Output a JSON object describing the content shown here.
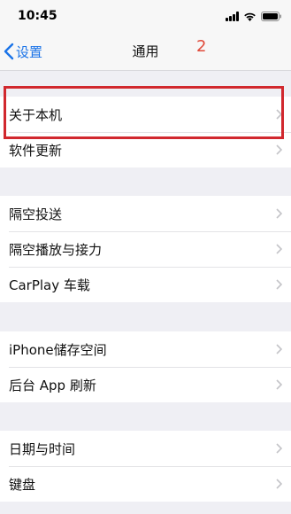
{
  "status_bar": {
    "time": "10:45"
  },
  "nav": {
    "back_label": "设置",
    "title": "通用"
  },
  "annotation": {
    "number": "2"
  },
  "groups": [
    {
      "items": [
        {
          "label": "关于本机"
        },
        {
          "label": "软件更新"
        }
      ]
    },
    {
      "items": [
        {
          "label": "隔空投送"
        },
        {
          "label": "隔空播放与接力"
        },
        {
          "label": "CarPlay 车载"
        }
      ]
    },
    {
      "items": [
        {
          "label": "iPhone储存空间"
        },
        {
          "label": "后台 App 刷新"
        }
      ]
    },
    {
      "items": [
        {
          "label": "日期与时间"
        },
        {
          "label": "键盘"
        }
      ]
    }
  ],
  "colors": {
    "accent": "#1a73e8",
    "highlight": "#d1282e",
    "annotation": "#e04a3a"
  }
}
